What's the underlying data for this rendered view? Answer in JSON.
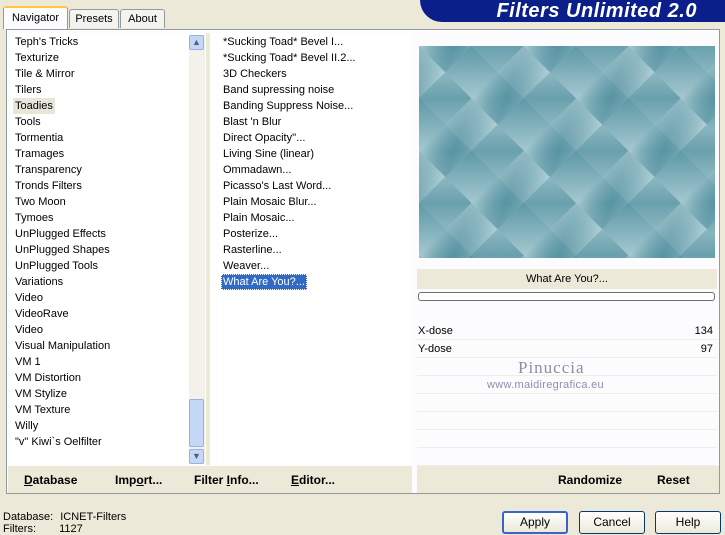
{
  "tabs": [
    {
      "label": "Navigator",
      "active": true
    },
    {
      "label": "Presets",
      "active": false
    },
    {
      "label": "About",
      "active": false
    }
  ],
  "banner": {
    "title": "Filters Unlimited 2.0"
  },
  "categories": [
    "Teph's Tricks",
    "Texturize",
    "Tile & Mirror",
    "Tilers",
    "Toadies",
    "Tools",
    "Tormentia",
    "Tramages",
    "Transparency",
    "Tronds Filters",
    "Two Moon",
    "Tymoes",
    "UnPlugged Effects",
    "UnPlugged Shapes",
    "UnPlugged Tools",
    "Variations",
    "Video",
    "VideoRave",
    "Video",
    "Visual Manipulation",
    "VM 1",
    "VM Distortion",
    "VM Stylize",
    "VM Texture",
    "Willy",
    "\"v\" Kiwi`s Oelfilter"
  ],
  "selected_category": "Toadies",
  "filters": [
    "*Sucking Toad*  Bevel I...",
    "*Sucking Toad*  Bevel II.2...",
    "3D Checkers",
    "Band supressing noise",
    "Banding Suppress Noise...",
    "Blast 'n Blur",
    "Direct Opacity''...",
    "Living Sine (linear)",
    "Ommadawn...",
    "Picasso's Last Word...",
    "Plain Mosaic Blur...",
    "Plain Mosaic...",
    "Posterize...",
    "Rasterline...",
    "Weaver...",
    "What Are You?..."
  ],
  "selected_filter": "What Are You?...",
  "preview": {
    "filter_name": "What Are You?..."
  },
  "params": [
    {
      "label": "X-dose",
      "value": "134"
    },
    {
      "label": "Y-dose",
      "value": "97"
    }
  ],
  "watermark": {
    "name": "Pinuccia",
    "url": "www.maidiregrafica.eu"
  },
  "toolbar": {
    "database": "Database",
    "import": "Import...",
    "filter_info": "Filter Info...",
    "editor": "Editor...",
    "randomize": "Randomize",
    "reset": "Reset"
  },
  "status": {
    "database_label": "Database:",
    "database_value": "ICNET-Filters",
    "filters_label": "Filters:",
    "filters_value": "1127"
  },
  "buttons": {
    "apply": "Apply",
    "cancel": "Cancel",
    "help": "Help"
  },
  "colors": {
    "accent": "#316ac5",
    "banner": "#0a1f8a",
    "preview_base": "#6fa4b0"
  }
}
